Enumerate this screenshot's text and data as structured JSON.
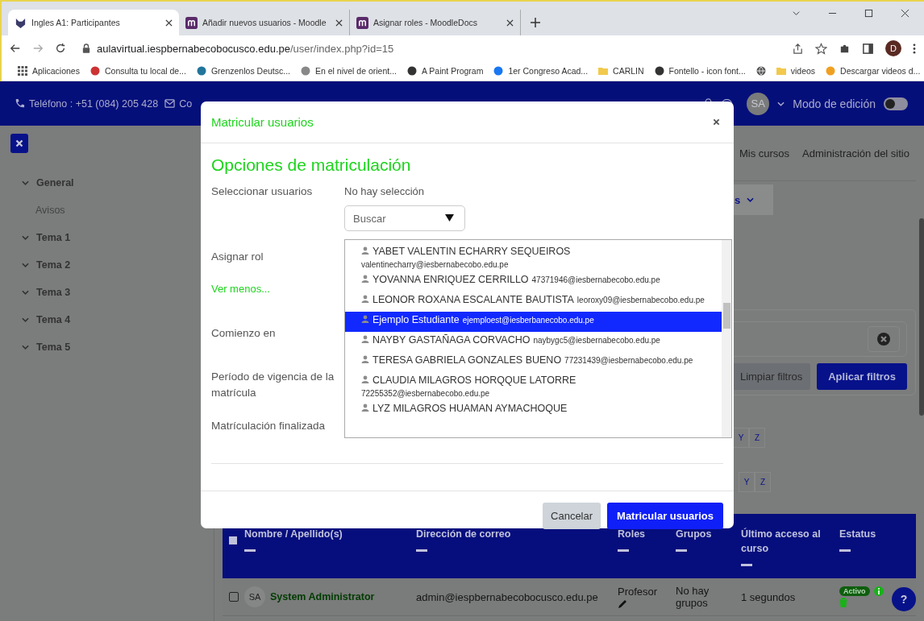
{
  "browser": {
    "tabs": [
      {
        "title": "Ingles A1: Participantes",
        "selected": true,
        "kind": "site"
      },
      {
        "title": "Añadir nuevos usuarios - Moodle",
        "selected": false,
        "kind": "moodle"
      },
      {
        "title": "Asignar roles - MoodleDocs",
        "selected": false,
        "kind": "moodle"
      }
    ],
    "url_host": "aulavirtual.iespbernabecobocusco.edu.pe",
    "url_path": "/user/index.php?id=15",
    "profile_initial": "D",
    "bookmarks": [
      {
        "kind": "apps",
        "label": "Aplicaciones"
      },
      {
        "kind": "local",
        "label": "Consulta tu local de..."
      },
      {
        "kind": "wordpress",
        "label": "Grenzenlos Deutsc..."
      },
      {
        "kind": "letter",
        "label": "En el nivel de orient..."
      },
      {
        "kind": "paint",
        "label": "A Paint Program"
      },
      {
        "kind": "facebook",
        "label": "1er Congreso Acad..."
      },
      {
        "kind": "folder",
        "label": "CARLIN"
      },
      {
        "kind": "fontello",
        "label": "Fontello - icon font..."
      },
      {
        "kind": "globe"
      },
      {
        "kind": "folder",
        "label": "videos"
      },
      {
        "kind": "video",
        "label": "Descargar videos d..."
      }
    ]
  },
  "top_bar": {
    "phone": "Teléfono : +51 (084) 205 428",
    "contact": "Co",
    "avatar": "SA",
    "edit_mode_label": "Modo de edición",
    "edit_mode_on": false
  },
  "sidebar": {
    "items": [
      {
        "label": "General",
        "children": [
          {
            "label": "Avisos"
          }
        ]
      },
      {
        "label": "Tema 1"
      },
      {
        "label": "Tema 2"
      },
      {
        "label": "Tema 3"
      },
      {
        "label": "Tema 4"
      },
      {
        "label": "Tema 5"
      }
    ]
  },
  "nav": [
    "Mis cursos",
    "Administración del sitio"
  ],
  "participants_menu": "s",
  "filters": {
    "clear": "Limpiar filtros",
    "apply": "Aplicar filtros"
  },
  "letter_rows": [
    [
      "Y",
      "Z"
    ],
    [
      "Y",
      "Z"
    ]
  ],
  "help_label": "?",
  "table": {
    "select_all_checked": false,
    "columns": [
      "Nombre / Apellido(s)",
      "Dirección de correo",
      "Roles",
      "Grupos",
      "Último acceso al curso",
      "Estatus"
    ],
    "rows": [
      {
        "selected": false,
        "avatar": "SA",
        "name": "System Administrator",
        "email": "admin@iespbernabecobocusco.edu.pe",
        "role": "Profesor",
        "groups": "No hay grupos",
        "last_access": "1 segundos",
        "status": "Activo"
      }
    ]
  },
  "modal": {
    "title": "Matricular usuarios",
    "heading": "Opciones de matriculación",
    "select_users_label": "Seleccionar usuarios",
    "selection": "No hay selección",
    "search_placeholder": "Buscar",
    "role_label": "Asignar rol",
    "less_link": "Ver menos...",
    "start_label": "Comienzo en",
    "duration_label": "Período de vigencia de la matrícula",
    "end_label": "Matrículación finalizada",
    "options": [
      {
        "name": "YABET VALENTIN ECHARRY SEQUEIROS",
        "email": "valentinecharry@iesbernabecobo.edu.pe",
        "selected": false
      },
      {
        "name": "YOVANNA ENRIQUEZ CERRILLO",
        "email": "47371946@iesbernabecobo.edu.pe",
        "selected": false
      },
      {
        "name": "LEONOR ROXANA ESCALANTE BAUTISTA",
        "email": "leoroxy09@iesbernabecobo.edu.pe",
        "selected": false
      },
      {
        "name": "Ejemplo Estudiante",
        "email": "ejemploest@iesberbanecobo.edu.pe",
        "selected": true
      },
      {
        "name": "NAYBY GASTAÑAGA CORVACHO",
        "email": "naybygc5@iesbernabecobo.edu.pe",
        "selected": false
      },
      {
        "name": "TERESA GABRIELA GONZALES BUENO",
        "email": "77231439@iesbernabecobo.edu.pe",
        "selected": false
      },
      {
        "name": "CLAUDIA MILAGROS HORQQUE LATORRE",
        "email": "72255352@iesbernabecobo.edu.pe",
        "selected": false
      },
      {
        "name": "LYZ MILAGROS HUAMAN AYMACHOQUE",
        "selected": false
      }
    ],
    "cancel": "Cancelar",
    "submit": "Matricular usuarios"
  }
}
